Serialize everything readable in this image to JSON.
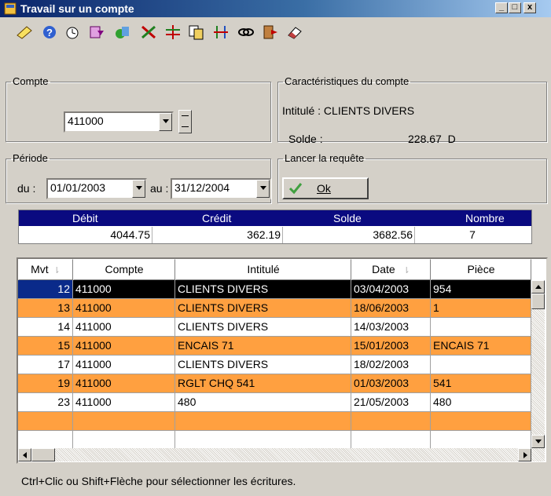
{
  "window": {
    "title": "Travail sur un compte",
    "buttons": [
      "_",
      "□",
      "x"
    ]
  },
  "toolbar": {
    "icons": [
      "note-icon",
      "help-icon",
      "clock-icon",
      "arrow-doc-icon",
      "money-icon",
      "tools-icon",
      "split-icon",
      "copy-icon",
      "sort-icon",
      "link-icon",
      "exit-icon",
      "eraser-icon"
    ]
  },
  "compte": {
    "legend": "Compte",
    "value": "411000"
  },
  "caracteristiques": {
    "legend": "Caractéristiques du compte",
    "intitule": "Intitulé : CLIENTS DIVERS",
    "solde_label": "Solde :",
    "solde_value": "228.67  D"
  },
  "periode": {
    "legend": "Période",
    "du_label": "du :",
    "du_value": "01/01/2003",
    "au_label": "au :",
    "au_value": "31/12/2004"
  },
  "requete": {
    "legend": "Lancer la requête",
    "ok_label": "Ok"
  },
  "summary": {
    "headers": [
      "Débit",
      "Crédit",
      "Solde",
      "Nombre"
    ],
    "values": [
      "4044.75",
      "362.19",
      "3682.56",
      "7"
    ]
  },
  "grid": {
    "columns": [
      "Mvt",
      "Compte",
      "Intitulé",
      "Date",
      "Pièce"
    ],
    "rows": [
      {
        "mvt": "12",
        "compte": "411000",
        "intitule": "CLIENTS DIVERS",
        "date": "03/04/2003",
        "piece": "954",
        "style": "selected"
      },
      {
        "mvt": "13",
        "compte": "411000",
        "intitule": "CLIENTS DIVERS",
        "date": "18/06/2003",
        "piece": "1",
        "style": "orange"
      },
      {
        "mvt": "14",
        "compte": "411000",
        "intitule": "CLIENTS DIVERS",
        "date": "14/03/2003",
        "piece": "",
        "style": "white"
      },
      {
        "mvt": "15",
        "compte": "411000",
        "intitule": "ENCAIS 71",
        "date": "15/01/2003",
        "piece": "ENCAIS 71",
        "style": "orange"
      },
      {
        "mvt": "17",
        "compte": "411000",
        "intitule": "CLIENTS DIVERS",
        "date": "18/02/2003",
        "piece": "",
        "style": "white"
      },
      {
        "mvt": "19",
        "compte": "411000",
        "intitule": "RGLT CHQ 541",
        "date": "01/03/2003",
        "piece": "541",
        "style": "orange"
      },
      {
        "mvt": "23",
        "compte": "411000",
        "intitule": "480",
        "date": "21/05/2003",
        "piece": "480",
        "style": "white"
      },
      {
        "mvt": "",
        "compte": "",
        "intitule": "",
        "date": "",
        "piece": "",
        "style": "orange"
      },
      {
        "mvt": "",
        "compte": "",
        "intitule": "",
        "date": "",
        "piece": "",
        "style": "white"
      }
    ]
  },
  "colors": {
    "selected_bg": "#000000",
    "orange_row": "#ffa040",
    "header_blue": "#0a0a80"
  },
  "status": {
    "text": "Ctrl+Clic ou Shift+Flèche pour sélectionner les écritures."
  }
}
